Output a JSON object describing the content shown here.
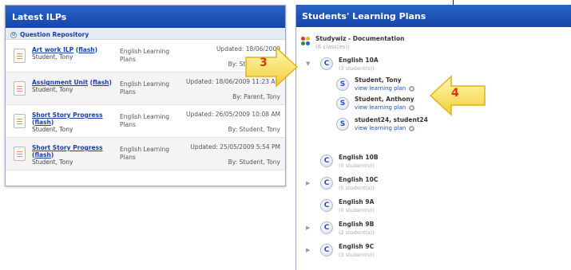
{
  "left_panel": {
    "title": "Latest ILPs",
    "repository": "Question Repository",
    "items": [
      {
        "title": "Art work ILP",
        "flash": "flash",
        "author": "Student, Tony",
        "category": "English Learning Plans",
        "updated": "Updated: 18/06/2009",
        "by": "By: Student, Tony"
      },
      {
        "title": "Assignment Unit",
        "flash": "flash",
        "author": "Student, Tony",
        "category": "English Learning Plans",
        "updated": "Updated: 18/06/2009 11:23 AM",
        "by": "By: Parent, Tony"
      },
      {
        "title": "Short Story Progress",
        "flash": "flash",
        "author": "Student, Tony",
        "category": "English Learning Plans",
        "updated": "Updated: 26/05/2009 10:08 AM",
        "by": "By: Student, Tony"
      },
      {
        "title": "Short Story Progress",
        "flash": "flash",
        "author": "Student, Tony",
        "category": "English Learning Plans",
        "updated": "Updated: 25/05/2009 5:54 PM",
        "by": "By: Student, Tony"
      }
    ]
  },
  "right_panel": {
    "title": "Students' Learning Plans",
    "root": {
      "name": "Studywiz - Documentation",
      "count": "(6 class(es))"
    },
    "view_label": "view learning plan",
    "classes": [
      {
        "name": "English 10A",
        "count": "(3 student(s))",
        "expander": "▼",
        "students": [
          {
            "name": "Student, Tony"
          },
          {
            "name": "Student, Anthony"
          },
          {
            "name": "student24, student24"
          }
        ]
      },
      {
        "name": "English 10B",
        "count": "(0 student(s))",
        "expander": ""
      },
      {
        "name": "English 10C",
        "count": "(5 student(s))",
        "expander": "▶"
      },
      {
        "name": "English 9A",
        "count": "(0 student(s))",
        "expander": ""
      },
      {
        "name": "English 9B",
        "count": "(2 student(s))",
        "expander": "▶"
      },
      {
        "name": "English 9C",
        "count": "(3 student(s))",
        "expander": "▶"
      }
    ]
  },
  "callouts": {
    "first": "3",
    "second": "4"
  },
  "icons": {
    "class": "C",
    "student": "S"
  }
}
